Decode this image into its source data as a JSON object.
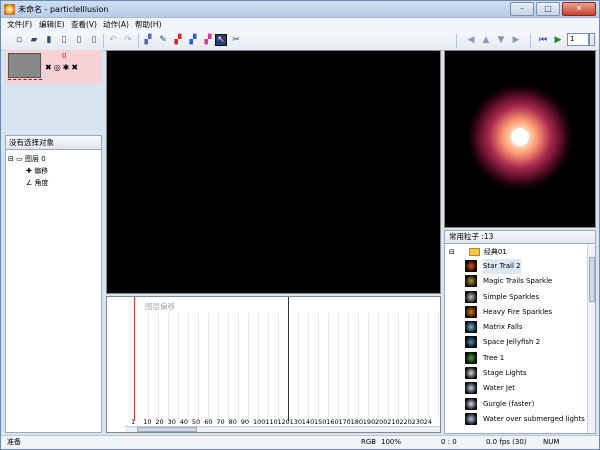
{
  "window": {
    "title": "未命名 - particleIllusion",
    "minimize_glyph": "–",
    "maximize_glyph": "□",
    "close_glyph": "✕"
  },
  "menu": [
    "文件(F)",
    "编辑(E)",
    "查看(V)",
    "动作(A)",
    "帮助(H)"
  ],
  "toolbar": {
    "frame_value": "1"
  },
  "layers": {
    "name": "0"
  },
  "properties": {
    "title": "没有选择对象",
    "tree_root": "图层 0",
    "tree_children": [
      "偏移",
      "角度"
    ]
  },
  "timeline": {
    "label": "图层偏移",
    "ticks": [
      "1",
      "10",
      "20",
      "30",
      "40",
      "50",
      "60",
      "70",
      "80",
      "90",
      "100",
      "110",
      "120",
      "130",
      "140",
      "150",
      "160",
      "170",
      "180",
      "190",
      "200",
      "210",
      "220",
      "230",
      "24"
    ]
  },
  "library": {
    "title": "常用粒子 :13",
    "folder": "经典01",
    "items": [
      "Star Trail 2",
      "Magic Trails Sparkle",
      "Simple Sparkles",
      "Heavy Fire Sparkles",
      "Matrix Falls",
      "Space Jellyfish 2",
      "Tree 1",
      "Stage Lights",
      "Water Jet",
      "Gurgle (faster)",
      "Water over submerged lights"
    ],
    "selected_index": 0
  },
  "status": {
    "ready": "准备",
    "color_mode": "RGB",
    "zoom": "100%",
    "position": "0 : 0",
    "fps": "0.0 fps (30)",
    "num": "NUM"
  }
}
